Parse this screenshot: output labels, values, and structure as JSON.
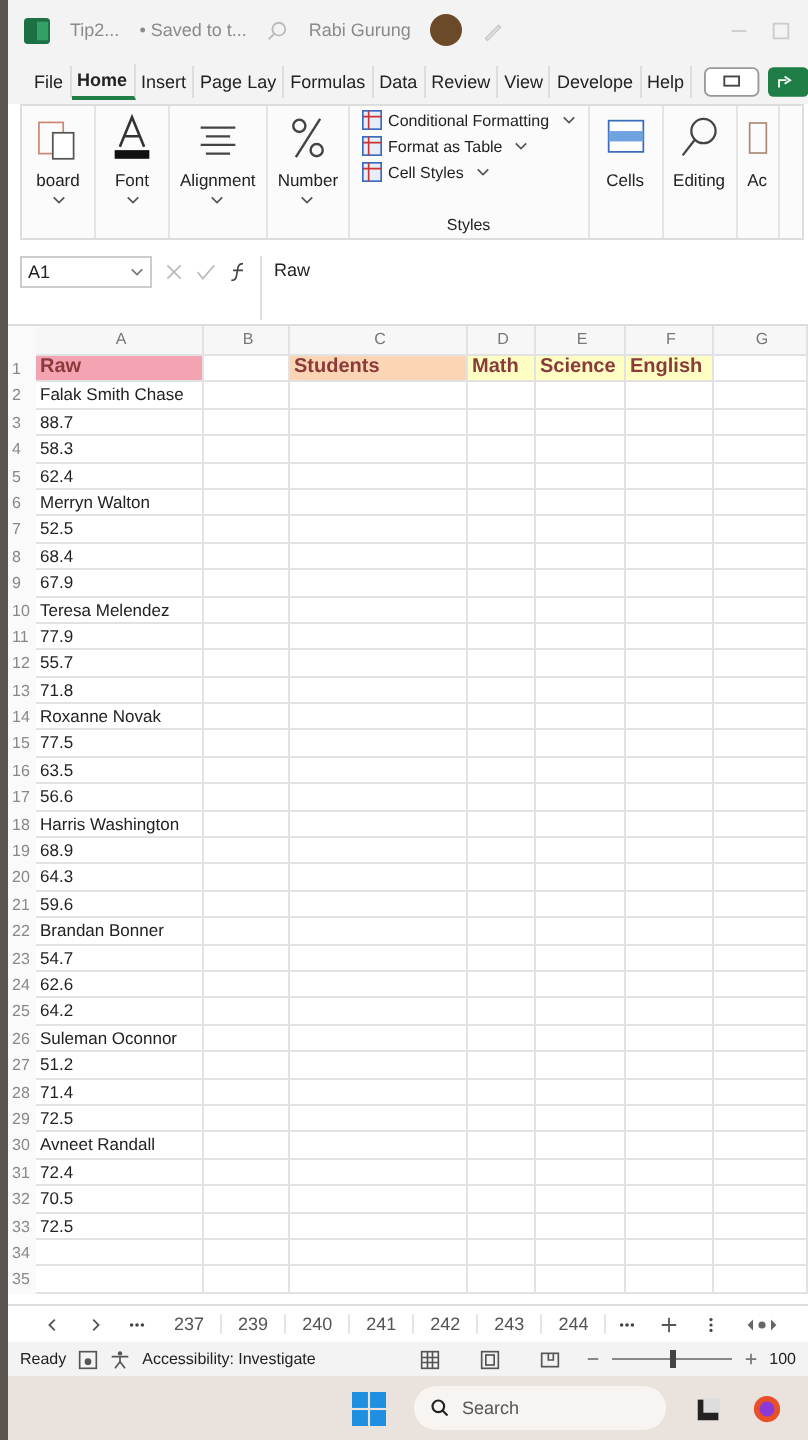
{
  "title_bar": {
    "file_name": "Tip2...",
    "save_status": "• Saved to t...",
    "user": "Rabi Gurung"
  },
  "tabs": [
    {
      "label": "File",
      "selected": false
    },
    {
      "label": "Home",
      "selected": true
    },
    {
      "label": "Insert",
      "selected": false
    },
    {
      "label": "Page Lay",
      "selected": false
    },
    {
      "label": "Formulas",
      "selected": false
    },
    {
      "label": "Data",
      "selected": false
    },
    {
      "label": "Review",
      "selected": false
    },
    {
      "label": "View",
      "selected": false
    },
    {
      "label": "Develope",
      "selected": false
    },
    {
      "label": "Help",
      "selected": false
    }
  ],
  "ribbon": {
    "big_buttons": [
      {
        "kind": "clipboard",
        "label": "board"
      },
      {
        "kind": "font",
        "label": "Font"
      },
      {
        "kind": "alignment",
        "label": "Alignment"
      },
      {
        "kind": "number",
        "label": "Number"
      }
    ],
    "styles": {
      "items": [
        "Conditional Formatting",
        "Format as Table",
        "Cell Styles"
      ],
      "group_label": "Styles"
    },
    "right_buttons": [
      {
        "kind": "cells",
        "label": "Cells"
      },
      {
        "kind": "editing",
        "label": "Editing"
      },
      {
        "kind": "addins",
        "label": "Ac"
      }
    ]
  },
  "formula_bar": {
    "name_box": "A1",
    "formula": "Raw"
  },
  "columns": [
    "A",
    "B",
    "C",
    "D",
    "E",
    "F",
    "G"
  ],
  "header_row": {
    "number": "1",
    "a": {
      "text": "Raw",
      "color": "#f4a3b3"
    },
    "c": {
      "text": "Students",
      "color": "#fcd5b4"
    },
    "d": {
      "text": "Math",
      "color": "#ffffc4"
    },
    "e": {
      "text": "Science",
      "color": "#ffffc4"
    },
    "f": {
      "text": "English",
      "color": "#ffffc4"
    }
  },
  "rows": [
    {
      "number": "2",
      "a": "Falak Smith Chase"
    },
    {
      "number": "3",
      "a": "88.7"
    },
    {
      "number": "4",
      "a": "58.3"
    },
    {
      "number": "5",
      "a": "62.4"
    },
    {
      "number": "6",
      "a": "Merryn Walton"
    },
    {
      "number": "7",
      "a": "52.5"
    },
    {
      "number": "8",
      "a": "68.4"
    },
    {
      "number": "9",
      "a": "67.9"
    },
    {
      "number": "10",
      "a": "Teresa Melendez"
    },
    {
      "number": "11",
      "a": "77.9"
    },
    {
      "number": "12",
      "a": "55.7"
    },
    {
      "number": "13",
      "a": "71.8"
    },
    {
      "number": "14",
      "a": "Roxanne Novak"
    },
    {
      "number": "15",
      "a": "77.5"
    },
    {
      "number": "16",
      "a": "63.5"
    },
    {
      "number": "17",
      "a": "56.6"
    },
    {
      "number": "18",
      "a": "Harris Washington"
    },
    {
      "number": "19",
      "a": "68.9"
    },
    {
      "number": "20",
      "a": "64.3"
    },
    {
      "number": "21",
      "a": "59.6"
    },
    {
      "number": "22",
      "a": "Brandan Bonner"
    },
    {
      "number": "23",
      "a": "54.7"
    },
    {
      "number": "24",
      "a": "62.6"
    },
    {
      "number": "25",
      "a": "64.2"
    },
    {
      "number": "26",
      "a": "Suleman Oconnor"
    },
    {
      "number": "27",
      "a": "51.2"
    },
    {
      "number": "28",
      "a": "71.4"
    },
    {
      "number": "29",
      "a": "72.5"
    },
    {
      "number": "30",
      "a": "Avneet Randall"
    },
    {
      "number": "31",
      "a": "72.4"
    },
    {
      "number": "32",
      "a": "70.5"
    },
    {
      "number": "33",
      "a": "72.5"
    },
    {
      "number": "34"
    },
    {
      "number": "35"
    }
  ],
  "sheet_tabs": [
    {
      "label": "237",
      "selected": false
    },
    {
      "label": "239",
      "selected": false
    },
    {
      "label": "240",
      "selected": false
    },
    {
      "label": "241",
      "selected": false
    },
    {
      "label": "242",
      "selected": false
    },
    {
      "label": "243",
      "selected": false
    },
    {
      "label": "244",
      "selected": false
    }
  ],
  "status_bar": {
    "status": "Ready",
    "accessibility": "Accessibility: Investigate",
    "zoom": {
      "level": 0.5
    },
    "zoom_reading": "100"
  },
  "taskbar": {
    "search": "Search"
  }
}
